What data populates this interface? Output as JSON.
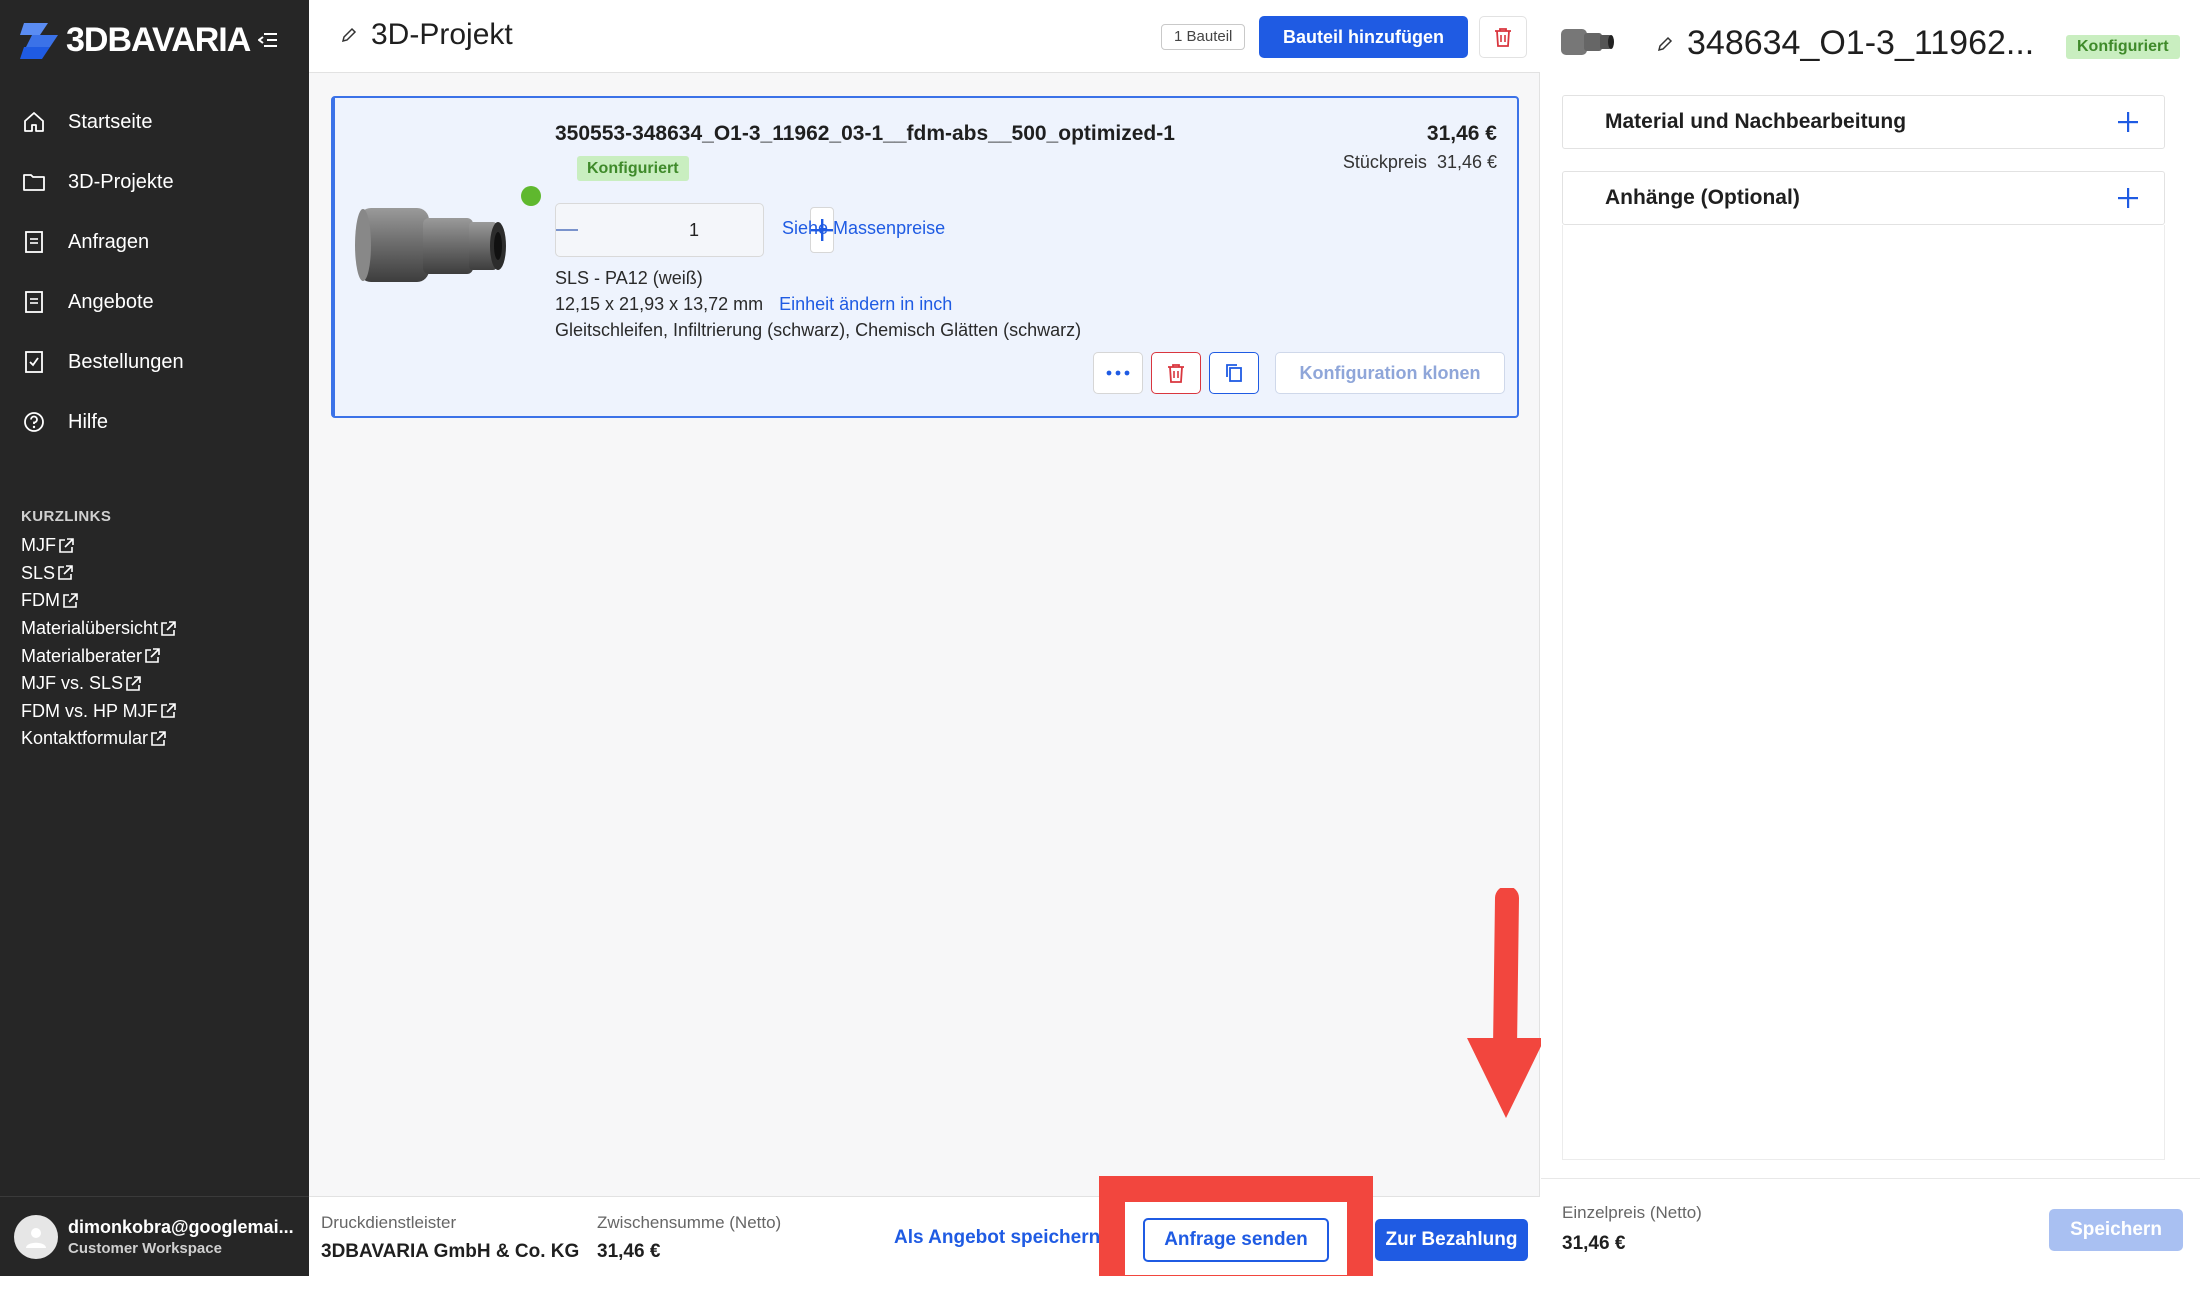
{
  "sidebar": {
    "brand": "3DBAVARIA",
    "nav": [
      {
        "label": "Startseite",
        "icon": "home-icon"
      },
      {
        "label": "3D-Projekte",
        "icon": "folder-icon"
      },
      {
        "label": "Anfragen",
        "icon": "document-icon"
      },
      {
        "label": "Angebote",
        "icon": "document-icon"
      },
      {
        "label": "Bestellungen",
        "icon": "checklist-icon"
      },
      {
        "label": "Hilfe",
        "icon": "help-icon"
      }
    ],
    "quicklinks_title": "KURZLINKS",
    "quicklinks": [
      "MJF",
      "SLS",
      "FDM",
      "Materialübersicht",
      "Materialberater",
      "MJF vs. SLS",
      "FDM vs. HP MJF",
      "Kontaktformular"
    ],
    "user": {
      "email": "dimonkobra@googlemai...",
      "workspace": "Customer Workspace"
    }
  },
  "header": {
    "title": "3D-Projekt",
    "part_count": "1 Bauteil",
    "add_part_label": "Bauteil hinzufügen"
  },
  "part": {
    "name": "350553-348634_O1-3_11962_03-1__fdm-abs__500_optimized-1",
    "status": "Konfiguriert",
    "price": "31,46 €",
    "unit_price_label": "Stückpreis",
    "unit_price": "31,46 €",
    "quantity": "1",
    "mass_prices_link": "Siehe Massenpreise",
    "material": "SLS - PA12 (weiß)",
    "dimensions": "12,15 x 21,93 x 13,72 mm",
    "unit_change_link": "Einheit ändern in inch",
    "finishing": "Gleitschleifen, Infiltrierung (schwarz), Chemisch Glätten (schwarz)",
    "clone_label": "Konfiguration klonen"
  },
  "footer": {
    "provider_label": "Druckdienstleister",
    "provider": "3DBAVARIA GmbH & Co. KG",
    "subtotal_label": "Zwischensumme (Netto)",
    "subtotal": "31,46 €",
    "save_offer_label": "Als Angebot speichern",
    "send_request_label": "Anfrage senden",
    "checkout_label": "Zur Bezahlung"
  },
  "right_panel": {
    "title": "348634_O1-3_11962...",
    "status": "Konfiguriert",
    "sections": [
      "Material und Nachbearbeitung",
      "Anhänge (Optional)"
    ],
    "price_label": "Einzelpreis (Netto)",
    "price": "31,46 €",
    "save_label": "Speichern"
  },
  "colors": {
    "accent": "#1f5be3",
    "sidebar_bg": "#262626",
    "success": "#5fb82e",
    "danger": "#d9363e",
    "annotation": "#f2463e"
  }
}
